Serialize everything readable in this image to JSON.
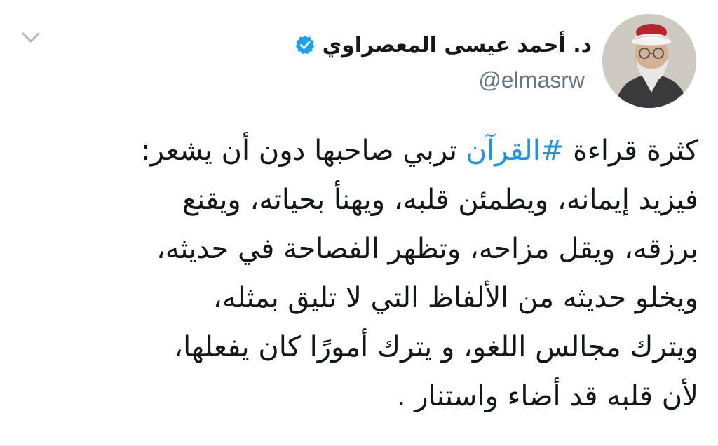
{
  "tweet": {
    "display_name": "د. أحمد عيسى المعصراوي",
    "handle": "@elmasrw",
    "verified": true,
    "colors": {
      "hashtag": "#1b95e0",
      "verified_badge": "#1da1f2",
      "handle": "#657786",
      "text": "#14171a"
    },
    "icons": {
      "menu": "chevron-down-icon",
      "badge": "verified-badge-icon"
    },
    "body": {
      "line1_before": "كثرة قراءة ",
      "hashtag": "#القرآن",
      "line1_after": " تربي صاحبها دون أن يشعر:",
      "line2": "فيزيد إيمانه، ويطمئن قلبه، ويهنأ بحياته، ويقنع",
      "line3": "برزقه، ويقل مزاحه، وتظهر الفصاحة في حديثه،",
      "line4": "ويخلو حديثه من الألفاظ التي لا تليق بمثله،",
      "line5": "ويترك مجالس اللغو، و يترك أمورًا كان يفعلها،",
      "line6": "لأن قلبه قد أضاء واستنار ."
    }
  }
}
